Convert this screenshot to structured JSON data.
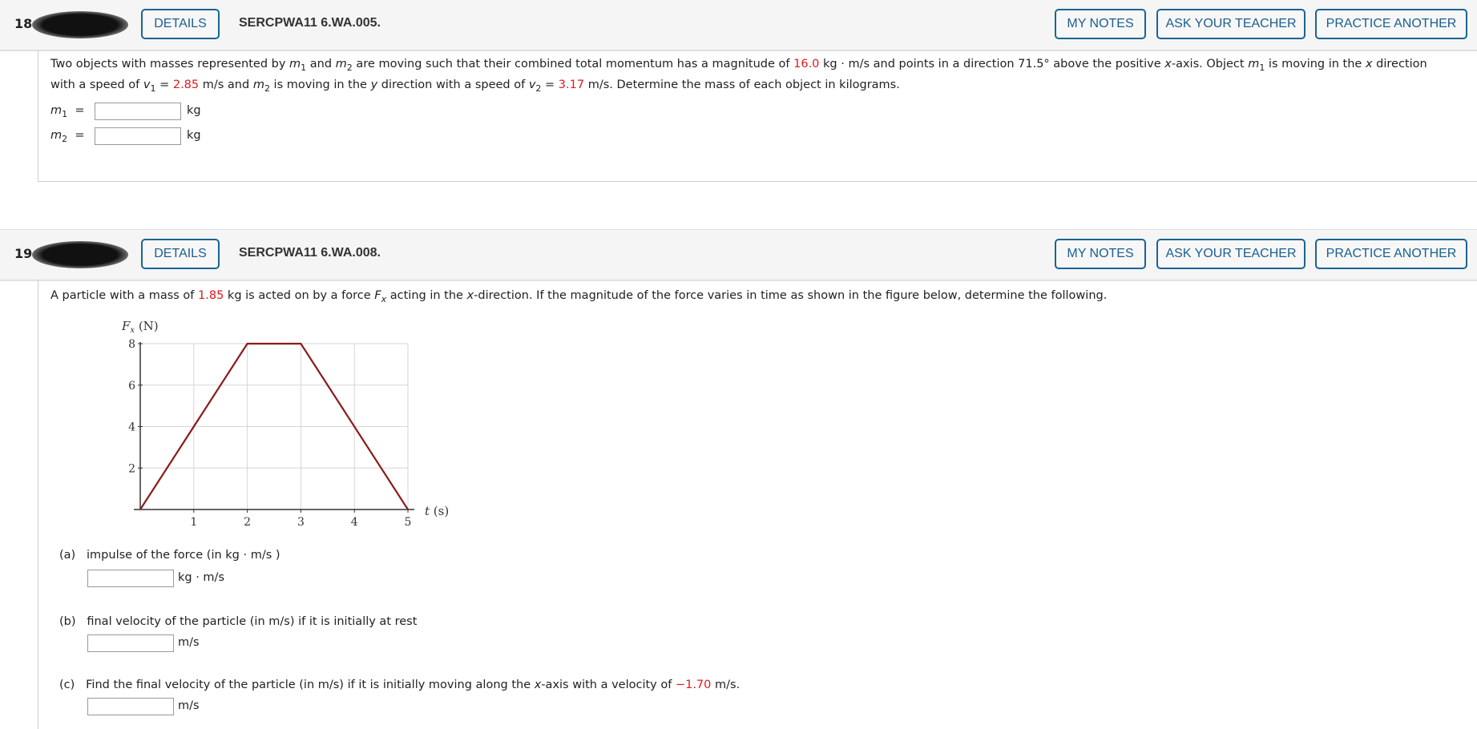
{
  "q18": {
    "number": "18.",
    "details": "DETAILS",
    "code": "SERCPWA11 6.WA.005.",
    "my_notes": "MY NOTES",
    "ask": "ASK YOUR TEACHER",
    "practice": "PRACTICE ANOTHER",
    "l1a": "Two objects with masses represented by ",
    "m": "m",
    "s1": "1",
    "s2": "2",
    "l1b": " and ",
    "l1c": " are moving such that their combined total momentum has a magnitude of ",
    "p": "16.0",
    "l1d": " kg · m/s and points in a direction 71.5° above the positive ",
    "x": "x",
    "l1e": "-axis. Object ",
    "l1f": " is moving in the ",
    "l1g": " direction",
    "l2a": "with a speed of ",
    "v": "v",
    "eq": " = ",
    "v1": "2.85",
    "l2b": " m/s and ",
    "l2c": " is moving in the ",
    "y": "y",
    "l2d": " direction with a speed of ",
    "v2": "3.17",
    "l2e": " m/s. Determine the mass of each object in kilograms.",
    "eqsign": "=",
    "unit": "kg"
  },
  "q19": {
    "number": "19.",
    "details": "DETAILS",
    "code": "SERCPWA11 6.WA.008.",
    "my_notes": "MY NOTES",
    "ask": "ASK YOUR TEACHER",
    "practice": "PRACTICE ANOTHER",
    "l1a": "A particle with a mass of ",
    "mass": "1.85",
    "l1b": " kg is acted on by a force ",
    "F": "F",
    "fx": "x",
    "l1c": " acting in the ",
    "x": "x",
    "l1d": "-direction. If the magnitude of the force varies in time as shown in the figure below, determine the following.",
    "parts": [
      {
        "label": "(a)",
        "text": "impulse of the force (in kg · m/s )",
        "unit": "kg · m/s"
      },
      {
        "label": "(b)",
        "text": "final velocity of the particle (in m/s) if it is initially at rest",
        "unit": "m/s"
      },
      {
        "label": "(c)",
        "text_a": "Find the final velocity of the particle (in m/s) if it is initially moving along the ",
        "x": "x",
        "text_b": "-axis with a velocity of ",
        "v0": "−1.70",
        "text_c": " m/s.",
        "unit": "m/s"
      }
    ]
  },
  "chart_data": {
    "type": "line",
    "ylabel": "Fx (N)",
    "xlabel": "t (s)",
    "xlim": [
      0,
      5
    ],
    "ylim": [
      0,
      8
    ],
    "xticks": [
      "1",
      "2",
      "3",
      "4",
      "5"
    ],
    "yticks": [
      "2",
      "4",
      "6",
      "8"
    ],
    "grid": true,
    "line_color": "#8b1a1a",
    "x": [
      0,
      2,
      3,
      5
    ],
    "y": [
      0,
      8,
      8,
      0
    ]
  }
}
